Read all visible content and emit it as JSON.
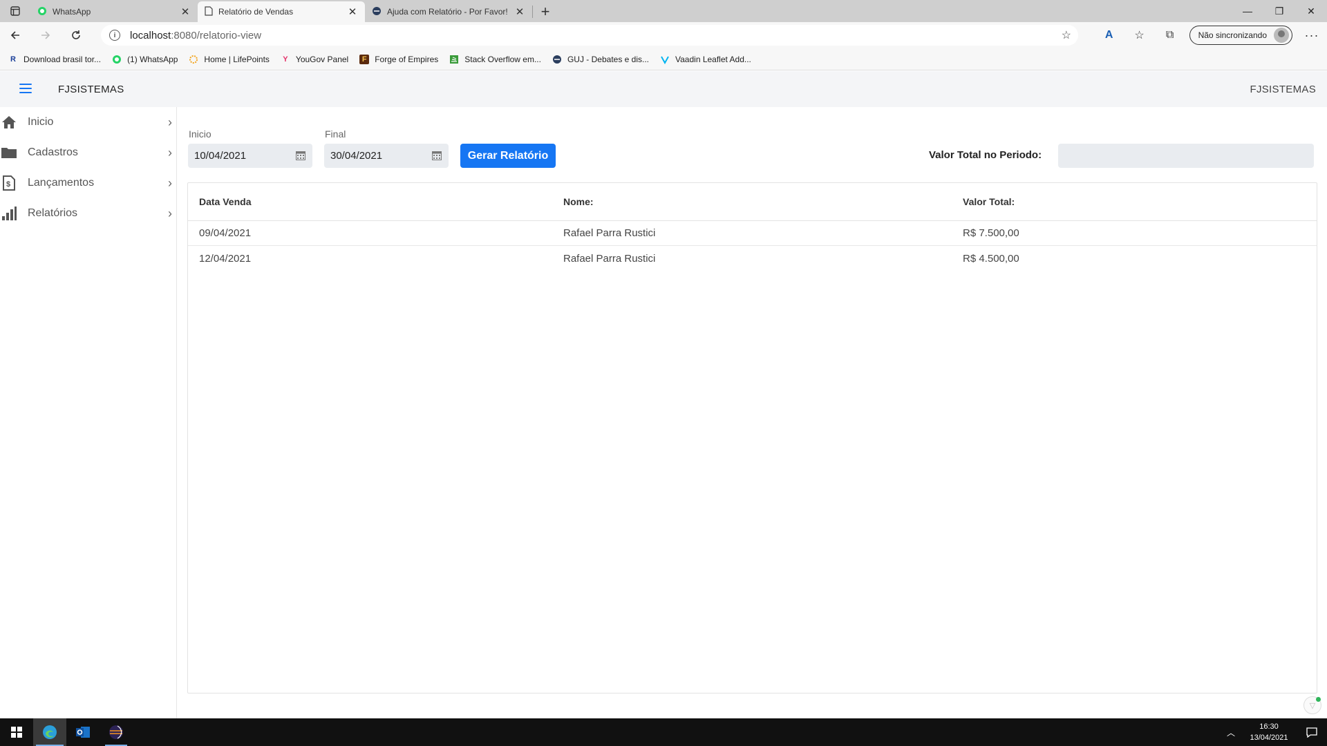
{
  "browser": {
    "tabs": [
      {
        "title": "WhatsApp",
        "active": false
      },
      {
        "title": "Relatório de Vendas",
        "active": true
      },
      {
        "title": "Ajuda com Relatório - Por Favor!",
        "active": false
      }
    ],
    "url_host": "localhost",
    "url_path": ":8080/relatorio-view",
    "sync_label": "Não sincronizando",
    "bookmarks": [
      {
        "label": "Download brasil tor...",
        "icon": "R",
        "color": "#1a3f99"
      },
      {
        "label": "(1) WhatsApp",
        "icon": "whatsapp-icon",
        "color": "#25d366"
      },
      {
        "label": "Home | LifePoints",
        "icon": "sun-icon",
        "color": "#f2a41c"
      },
      {
        "label": "YouGov Panel",
        "icon": "Y",
        "color": "#e5336b"
      },
      {
        "label": "Forge of Empires",
        "icon": "F",
        "color": "#5b2a0e"
      },
      {
        "label": "Stack Overflow em...",
        "icon": "stackoverflow-icon",
        "color": "#3a9b3a"
      },
      {
        "label": "GUJ - Debates e dis...",
        "icon": "guj-icon",
        "color": "#2b3e5e"
      },
      {
        "label": "Vaadin Leaflet Add...",
        "icon": "vaadin-icon",
        "color": "#00b4f0"
      }
    ]
  },
  "app": {
    "brand": "FJSISTEMAS",
    "brand_right": "FJSISTEMAS",
    "accent": "#1676f3"
  },
  "sidebar": {
    "items": [
      {
        "label": "Inicio",
        "icon": "home-icon"
      },
      {
        "label": "Cadastros",
        "icon": "folder-icon"
      },
      {
        "label": "Lançamentos",
        "icon": "document-dollar-icon"
      },
      {
        "label": "Relatórios",
        "icon": "bar-chart-icon"
      }
    ]
  },
  "form": {
    "start_label": "Inicio",
    "start_value": "10/04/2021",
    "end_label": "Final",
    "end_value": "30/04/2021",
    "generate_button": "Gerar Relatório",
    "total_label": "Valor Total no Periodo:",
    "total_value": ""
  },
  "grid": {
    "columns": [
      "Data Venda",
      "Nome:",
      "Valor Total:"
    ],
    "rows": [
      [
        "09/04/2021",
        "Rafael Parra Rustici",
        "R$ 7.500,00"
      ],
      [
        "12/04/2021",
        "Rafael Parra Rustici",
        "R$ 4.500,00"
      ]
    ]
  },
  "taskbar": {
    "time": "16:30",
    "date": "13/04/2021"
  }
}
